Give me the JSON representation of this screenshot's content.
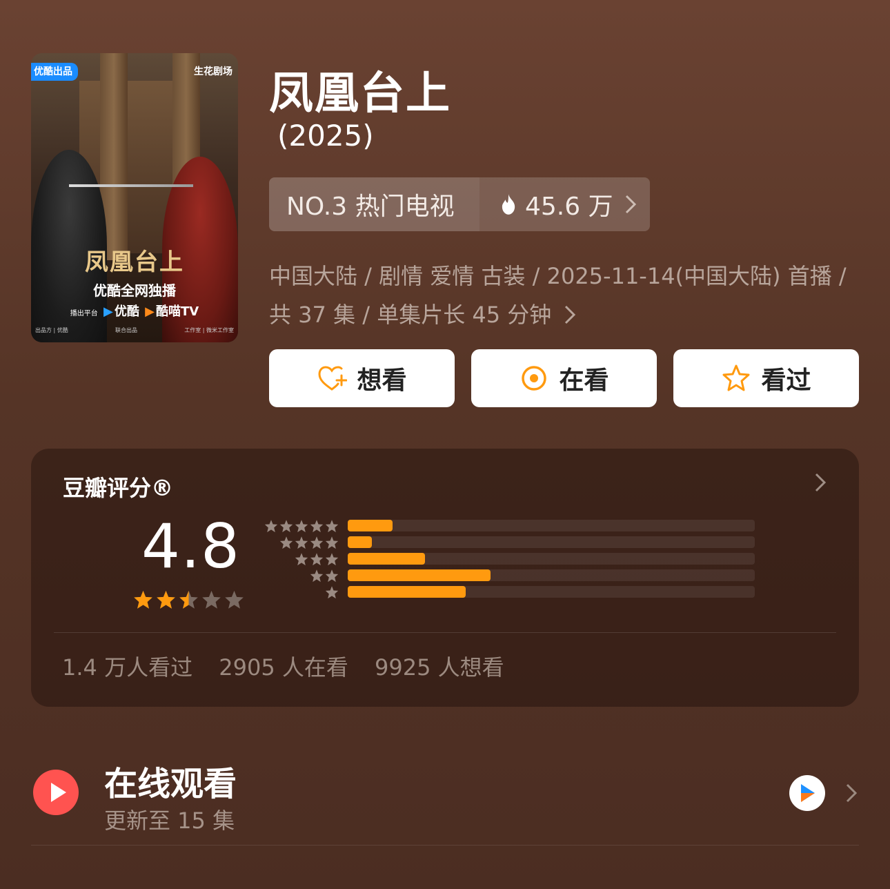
{
  "poster": {
    "badge": "优酷出品",
    "studio": "生花剧场",
    "title": "凤凰台上",
    "exclusive": "优酷全网独播",
    "platform_label": "播出平台",
    "platform1": "优酷",
    "platform2": "酷喵TV",
    "credit_left": "出品方 | 优酷",
    "credit_mid": "联合出品",
    "credit_right": "工作室 | 微米工作室"
  },
  "show": {
    "title": "凤凰台上",
    "year": "(2025)",
    "rank": "NO.3 热门电视",
    "heat": "45.6 万",
    "meta_line1": "中国大陆 / 剧情 爱情 古装 / 2025-11-14(中国大陆) 首播 /",
    "meta_line2": "共 37 集 / 单集片长 45 分钟"
  },
  "actions": {
    "want": "想看",
    "watching": "在看",
    "watched": "看过"
  },
  "rating": {
    "title": "豆瓣评分®",
    "score": "4.8",
    "stars_value": 2.5,
    "distribution": [
      {
        "stars": 5,
        "fraction": 0.11
      },
      {
        "stars": 4,
        "fraction": 0.06
      },
      {
        "stars": 3,
        "fraction": 0.19
      },
      {
        "stars": 2,
        "fraction": 0.35
      },
      {
        "stars": 1,
        "fraction": 0.29
      }
    ],
    "stats": {
      "watched": "1.4 万人看过",
      "watching": "2905 人在看",
      "want": "9925 人想看"
    }
  },
  "online": {
    "title": "在线观看",
    "subtitle": "更新至 15 集"
  },
  "colors": {
    "accent": "#ff9a0f",
    "play": "#ff5350"
  }
}
